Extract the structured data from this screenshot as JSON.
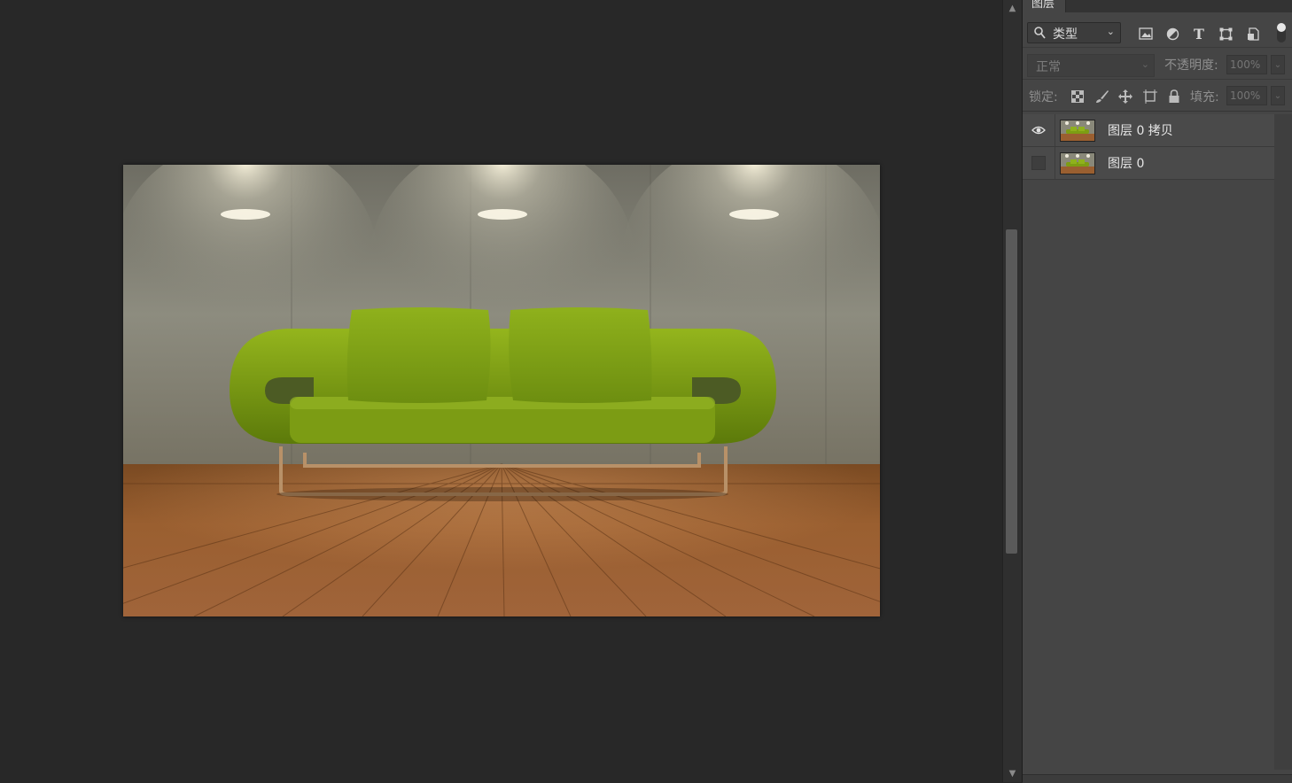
{
  "canvas": {
    "image_description": "green sofa on wooden floor against concrete wall with three spotlights"
  },
  "layers_panel": {
    "tab_label": "图层",
    "filter": {
      "kind_label": "类型",
      "icons": [
        "image-filter-icon",
        "adjustment-filter-icon",
        "type-filter-icon",
        "shape-filter-icon",
        "smart-object-filter-icon"
      ]
    },
    "blend_mode": "正常",
    "opacity_label": "不透明度:",
    "opacity_value": "100%",
    "lock_label": "锁定:",
    "lock_icons": [
      "lock-transparent-icon",
      "lock-paint-icon",
      "lock-position-icon",
      "lock-artboard-icon",
      "lock-all-icon"
    ],
    "fill_label": "填充:",
    "fill_value": "100%",
    "layers": [
      {
        "name": "图层 0 拷贝",
        "visible": true
      },
      {
        "name": "图层 0",
        "visible": false
      }
    ]
  }
}
